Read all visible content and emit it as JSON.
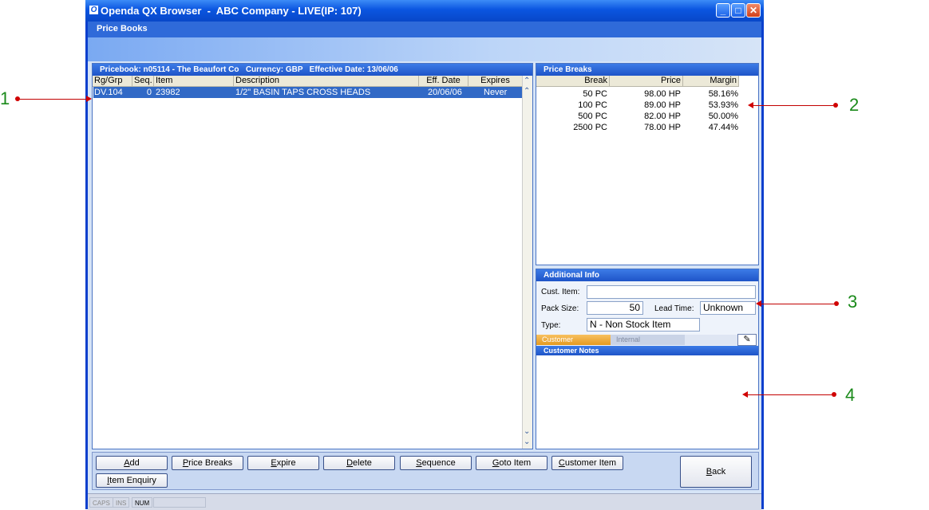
{
  "window": {
    "title": "Openda QX Browser  -  ABC Company - LIVE(IP: 107)",
    "logo_glyph": "O",
    "subtitle": "Price Books"
  },
  "pricebook": {
    "header": "Pricebook: n05114 - The Beaufort Co   Currency: GBP   Effective Date: 13/06/06",
    "columns": [
      "Rg/Grp",
      "Seq.",
      "Item",
      "Description",
      "Eff. Date",
      "Expires"
    ],
    "rows": [
      {
        "rg": "DV.104",
        "seq": "0",
        "item": "23982",
        "desc": "1/2\" BASIN TAPS CROSS HEADS",
        "eff": "20/06/06",
        "expires": "Never"
      }
    ]
  },
  "price_breaks": {
    "header": "Price Breaks",
    "columns": [
      "Break",
      "Price",
      "Margin"
    ],
    "rows": [
      {
        "brk": "50 PC",
        "price": "98.00 HP",
        "margin": "58.16%"
      },
      {
        "brk": "100 PC",
        "price": "89.00 HP",
        "margin": "53.93%"
      },
      {
        "brk": "500 PC",
        "price": "82.00 HP",
        "margin": "50.00%"
      },
      {
        "brk": "2500 PC",
        "price": "78.00 HP",
        "margin": "47.44%"
      }
    ]
  },
  "additional_info": {
    "header": "Additional Info",
    "cust_item_label": "Cust. Item:",
    "cust_item_value": "",
    "pack_size_label": "Pack Size:",
    "pack_size_value": "50",
    "lead_time_label": "Lead Time:",
    "lead_time_value": "Unknown",
    "type_label": "Type:",
    "type_value": "N - Non Stock Item"
  },
  "notes": {
    "tabs": [
      "Customer",
      "Internal"
    ],
    "header": "Customer Notes"
  },
  "buttons": [
    {
      "label": "Add",
      "ul": "A",
      "rest": "dd"
    },
    {
      "label": "Price Breaks",
      "ul": "P",
      "rest": "rice Breaks"
    },
    {
      "label": "Expire",
      "ul": "E",
      "rest": "xpire"
    },
    {
      "label": "Delete",
      "ul": "D",
      "rest": "elete"
    },
    {
      "label": "Sequence",
      "ul": "S",
      "rest": "equence"
    },
    {
      "label": "Goto Item",
      "ul": "G",
      "rest": "oto Item"
    },
    {
      "label": "Customer Item",
      "ul": "C",
      "rest": "ustomer Item"
    },
    {
      "label": "Item Enquiry",
      "ul": "I",
      "rest": "tem Enquiry"
    },
    {
      "label": "Back",
      "ul": "B",
      "rest": "ack"
    }
  ],
  "status": {
    "caps": "CAPS",
    "ins": "INS",
    "num": "NUM"
  },
  "annotations": [
    "1",
    "2",
    "3",
    "4"
  ],
  "colors": {
    "titlebar": "#0a55e0",
    "selection": "#3169c6",
    "annotation": "#1a8a1a",
    "arrow": "#d00000"
  }
}
